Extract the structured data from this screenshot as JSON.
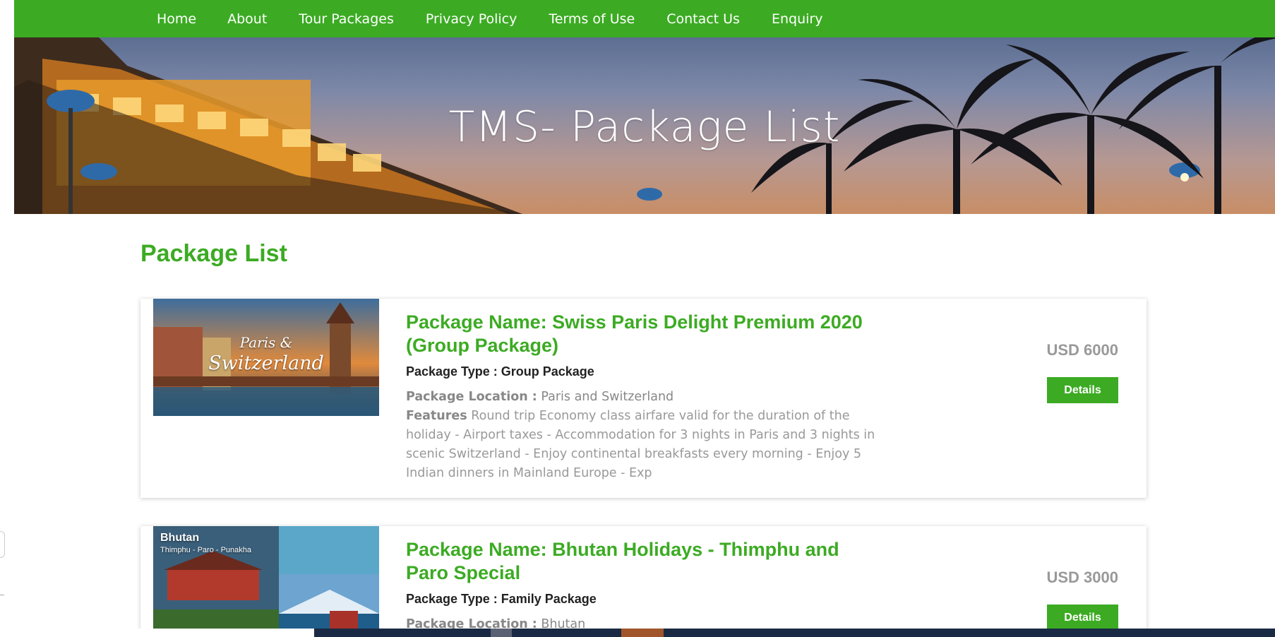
{
  "nav": {
    "items": [
      "Home",
      "About",
      "Tour Packages",
      "Privacy Policy",
      "Terms of Use",
      "Contact Us",
      "Enquiry"
    ]
  },
  "banner": {
    "title": "TMS- Package List"
  },
  "section": {
    "title": "Package List"
  },
  "packages": [
    {
      "thumb_text_1": "Paris &",
      "thumb_text_2": "Switzerland",
      "name": "Package Name: Swiss Paris Delight Premium 2020 (Group Package)",
      "type": "Package Type : Group Package",
      "location_label": "Package Location :",
      "location": "Paris and Switzerland",
      "features_label": "Features",
      "features": "Round trip Economy class airfare valid for the duration of the holiday - Airport taxes - Accommodation for 3 nights in Paris and 3 nights in scenic Switzerland - Enjoy continental breakfasts every morning - Enjoy 5 Indian dinners in Mainland Europe - Exp",
      "price": "USD 6000",
      "button": "Details"
    },
    {
      "thumb_text_1": "Bhutan",
      "thumb_text_2": "Thimphu - Paro - Punakha",
      "name": "Package Name: Bhutan Holidays - Thimphu and Paro Special",
      "type": "Package Type : Family Package",
      "location_label": "Package Location :",
      "location": "Bhutan",
      "price": "USD 3000",
      "button": "Details"
    }
  ],
  "colors": {
    "brand_green": "#3cab23",
    "text_gray": "#999999"
  }
}
